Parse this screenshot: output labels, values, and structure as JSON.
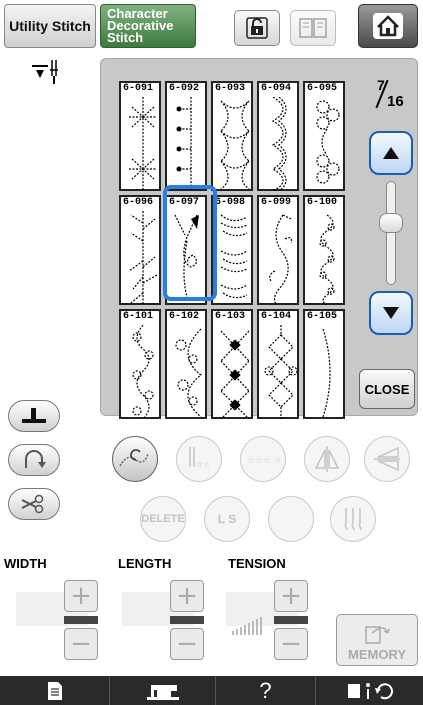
{
  "header": {
    "tab_utility": "Utility Stitch",
    "tab_character": [
      "Character",
      "Decorative",
      "Stitch"
    ]
  },
  "stitches": [
    [
      "6-091",
      "6-092",
      "6-093",
      "6-094",
      "6-095"
    ],
    [
      "6-096",
      "6-097",
      "6-098",
      "6-099",
      "6-100"
    ],
    [
      "6-101",
      "6-102",
      "6-103",
      "6-104",
      "6-105"
    ]
  ],
  "selected_stitch": "6-097",
  "page": {
    "current": "7",
    "total": "16"
  },
  "close_label": "CLOSE",
  "function_buttons": {
    "delete": "DELETE",
    "ls": "L S"
  },
  "labels": {
    "width": "WIDTH",
    "length": "LENGTH",
    "tension": "TENSION"
  },
  "memory_label": "MEMORY",
  "help_label": "?",
  "colors": {
    "selection": "#2a7de1",
    "accent_green": "#3f7a3f",
    "scroll_blue": "#1a5fae"
  }
}
